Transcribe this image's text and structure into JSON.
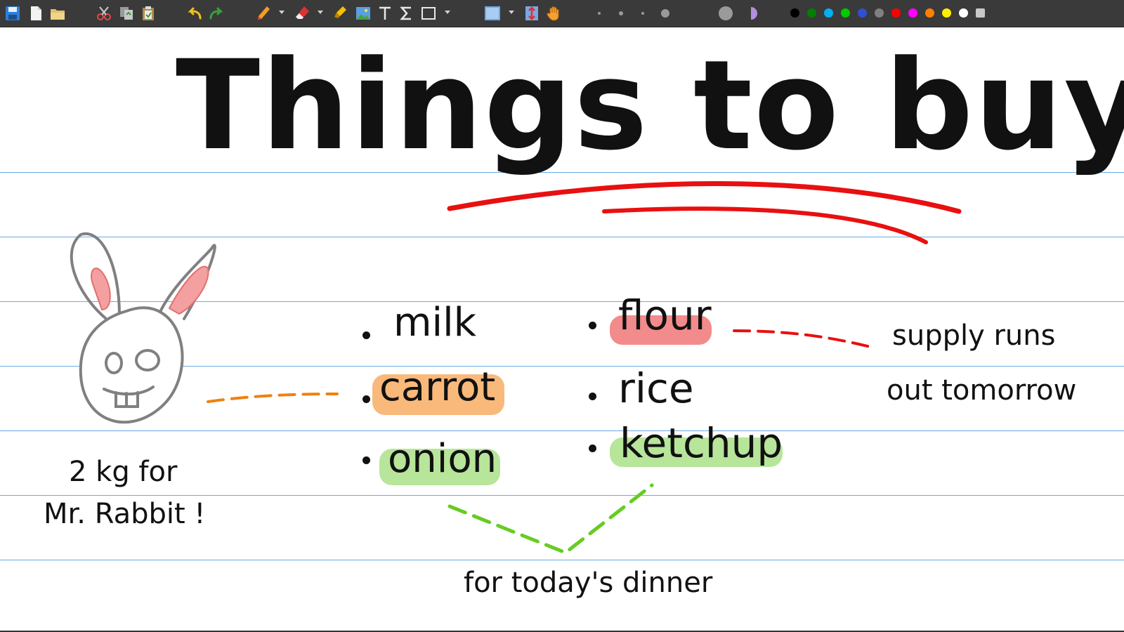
{
  "toolbar": {
    "tools": [
      {
        "name": "save-icon"
      },
      {
        "name": "new-page-icon"
      },
      {
        "name": "open-folder-icon"
      },
      {
        "name": "cut-icon"
      },
      {
        "name": "copy-icon"
      },
      {
        "name": "paste-icon"
      },
      {
        "name": "undo-icon"
      },
      {
        "name": "redo-icon"
      },
      {
        "name": "pen-icon"
      },
      {
        "name": "eraser-icon"
      },
      {
        "name": "highlighter-icon"
      },
      {
        "name": "image-icon"
      },
      {
        "name": "text-icon"
      },
      {
        "name": "formula-icon"
      },
      {
        "name": "shape-icon"
      },
      {
        "name": "select-icon"
      },
      {
        "name": "vertical-space-icon"
      },
      {
        "name": "hand-icon"
      }
    ],
    "colors": [
      "#000000",
      "#008000",
      "#00b0f0",
      "#00cc00",
      "#3050d0",
      "#808080",
      "#ff0000",
      "#ff00ff",
      "#ff8000",
      "#ffee00",
      "#ffffff",
      "#c8c8c8"
    ]
  },
  "note": {
    "title": "Things to buy",
    "items_left": [
      "milk",
      "carrot",
      "onion"
    ],
    "items_right": [
      "flour",
      "rice",
      "ketchup"
    ],
    "annotation_supply": [
      "supply runs",
      "out tomorrow"
    ],
    "annotation_rabbit": [
      "2 kg for",
      "Mr. Rabbit !"
    ],
    "annotation_dinner": "for today's dinner",
    "highlight_colors": {
      "carrot": "#f9b97a",
      "flour": "#f28b8b",
      "onion": "#b7e59a",
      "ketchup": "#b7e59a"
    }
  }
}
